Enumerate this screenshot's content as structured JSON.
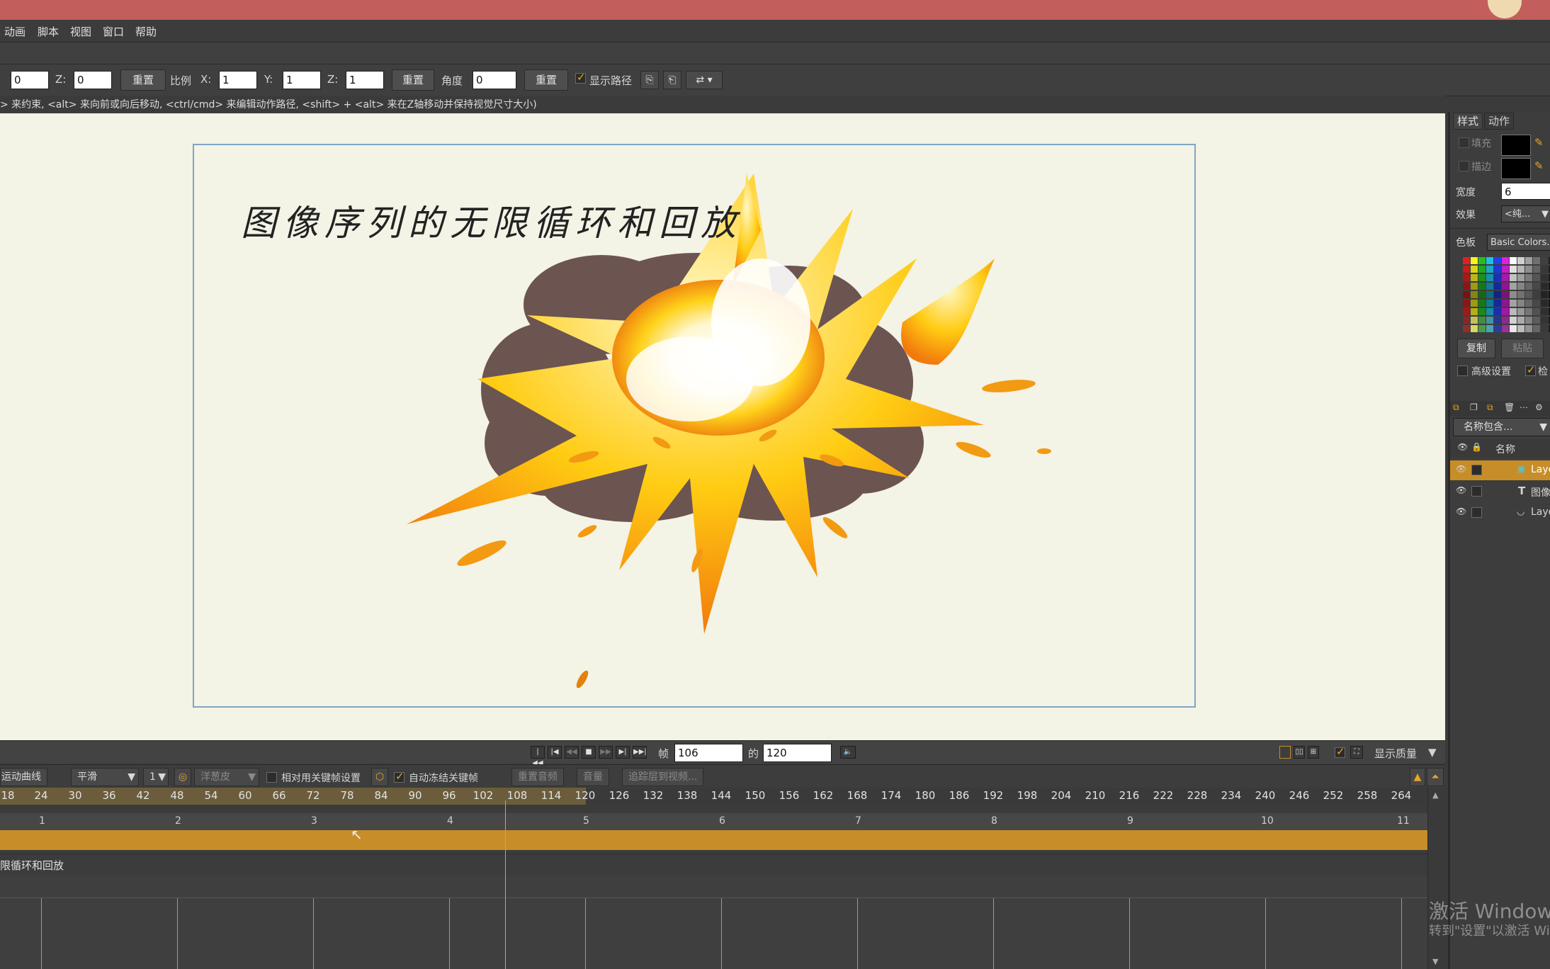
{
  "menu": {
    "items": [
      "动画",
      "脚本",
      "视图",
      "窗口",
      "帮助"
    ]
  },
  "transform": {
    "x_value": "0",
    "z_label": "Z:",
    "z_value": "0",
    "reset1": "重置",
    "scale_label": "比例",
    "sx_label": "X:",
    "sx_value": "1",
    "sy_label": "Y:",
    "sy_value": "1",
    "sz_label": "Z:",
    "sz_value": "1",
    "reset2": "重置",
    "angle_label": "角度",
    "angle_value": "0",
    "reset3": "重置",
    "show_path_label": "显示路径"
  },
  "hint": "> 来约束, <alt> 来向前或向后移动, <ctrl/cmd> 来编辑动作路径, <shift> + <alt> 来在Z轴移动并保持视觉尺寸大小)",
  "stage": {
    "title": "图像序列的无限循环和回放"
  },
  "playback": {
    "frame_label": "帧",
    "frame_value": "106",
    "of_label": "的",
    "total_value": "120",
    "quality_label": "显示质量"
  },
  "timeline_toolbar": {
    "motion_curve": "运动曲线",
    "smooth": "平滑",
    "step": "1",
    "onion": "洋葱皮",
    "relative_keys": "相对用关键帧设置",
    "auto_freeze": "自动冻结关键帧",
    "reset_audio": "重置音频",
    "volume": "音量",
    "track_to_video": "追踪层到视频..."
  },
  "ruler": {
    "ticks": [
      "18",
      "24",
      "30",
      "36",
      "42",
      "48",
      "54",
      "60",
      "66",
      "72",
      "78",
      "84",
      "90",
      "96",
      "102",
      "108",
      "114",
      "120",
      "126",
      "132",
      "138",
      "144",
      "150",
      "156",
      "162",
      "168",
      "174",
      "180",
      "186",
      "192",
      "198",
      "204",
      "210",
      "216",
      "222",
      "228",
      "234",
      "240",
      "246",
      "252",
      "258",
      "264"
    ],
    "seconds": [
      "1",
      "2",
      "3",
      "4",
      "5",
      "6",
      "7",
      "8",
      "9",
      "10",
      "11"
    ]
  },
  "layer_row_label": "限循环和回放",
  "panel": {
    "tab_style": "样式",
    "tab_action": "动作",
    "fill_label": "填充",
    "stroke_label": "描边",
    "width_label": "宽度",
    "width_value": "6",
    "effect_label": "效果",
    "effect_value": "<纯...",
    "palette_label": "色板",
    "palette_value": "Basic Colors.",
    "copy_label": "复制",
    "paste_label": "粘贴",
    "advanced_label": "高级设置",
    "check_label": "检",
    "filter_value": "名称包含...",
    "name_header": "名称",
    "layers": [
      {
        "name": "Laye",
        "type": "image"
      },
      {
        "name": "图像",
        "type": "text"
      },
      {
        "name": "Laye",
        "type": "vector"
      }
    ],
    "colors": {
      "selected_layer": "#c78d28",
      "fill": "#000000",
      "stroke": "#000000"
    }
  },
  "watermark": {
    "line1": "激活 Windows",
    "line2": "转到\"设置\"以激活 Wi"
  }
}
